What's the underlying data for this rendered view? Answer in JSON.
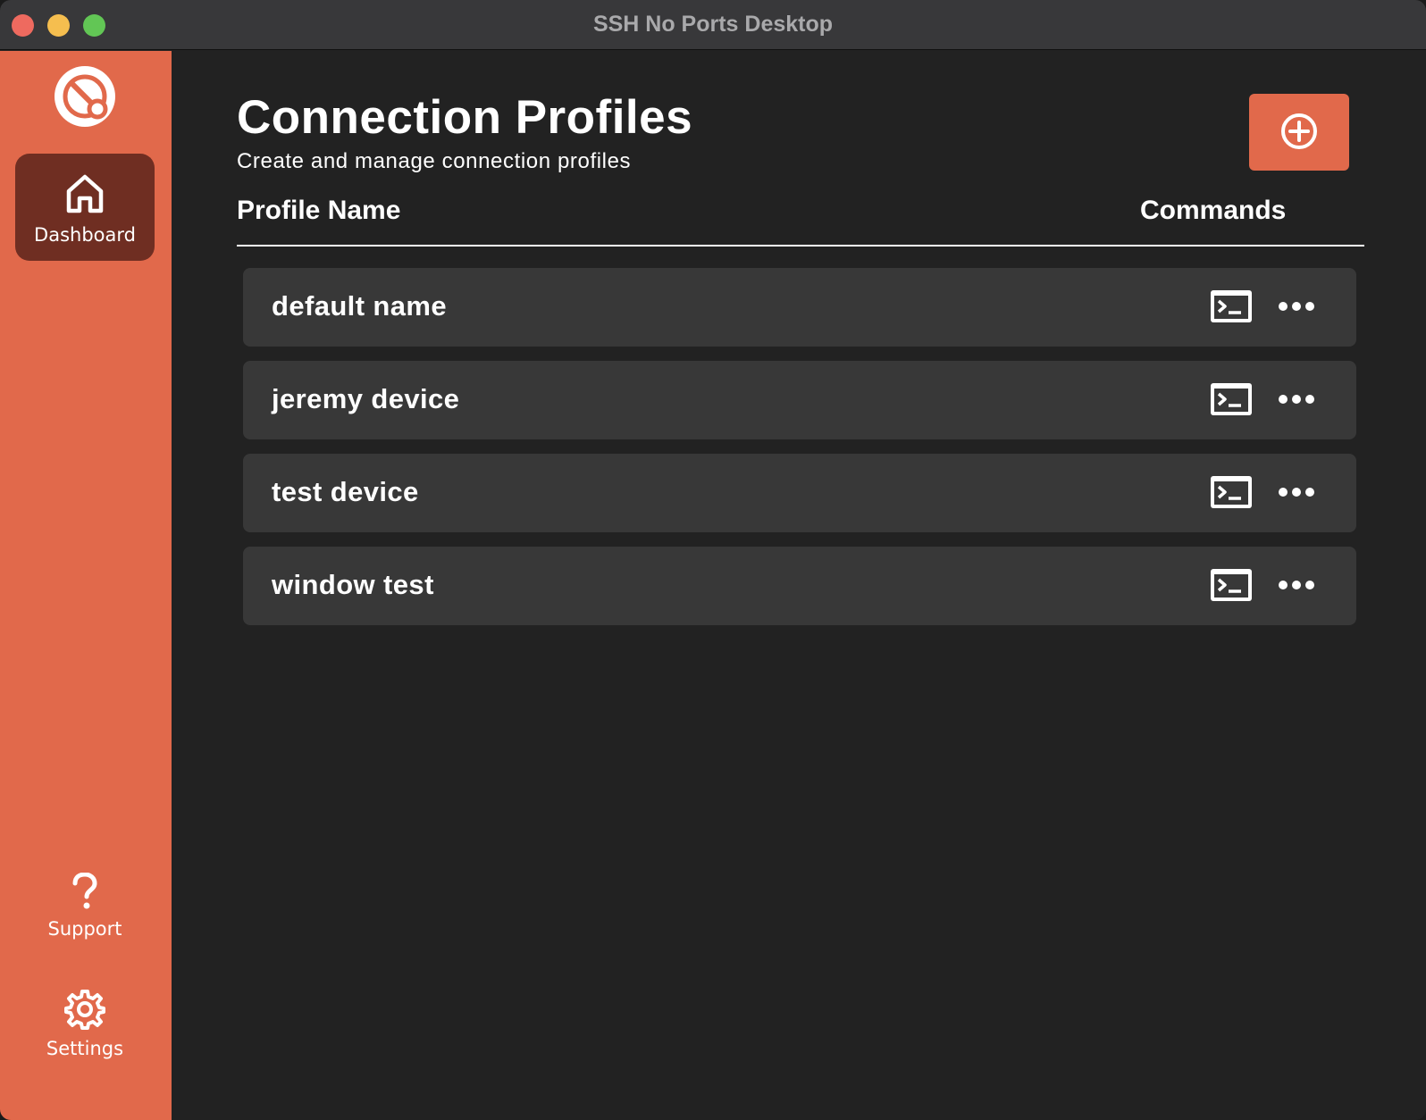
{
  "window": {
    "title": "SSH No Ports Desktop"
  },
  "sidebar": {
    "logo_icon": "sshnp-logo-icon",
    "items": [
      {
        "label": "Dashboard",
        "icon": "home-icon",
        "active": true
      },
      {
        "label": "Support",
        "icon": "question-mark-icon",
        "active": false
      },
      {
        "label": "Settings",
        "icon": "gear-icon",
        "active": false
      }
    ]
  },
  "main": {
    "title": "Connection Profiles",
    "subtitle": "Create and manage connection profiles",
    "add_button_icon": "plus-circle-icon",
    "columns": {
      "name": "Profile Name",
      "commands": "Commands"
    },
    "profiles": [
      {
        "name": "default name",
        "terminal_icon": "terminal-icon",
        "more_icon": "more-horizontal-icon"
      },
      {
        "name": "jeremy device",
        "terminal_icon": "terminal-icon",
        "more_icon": "more-horizontal-icon"
      },
      {
        "name": "test device",
        "terminal_icon": "terminal-icon",
        "more_icon": "more-horizontal-icon"
      },
      {
        "name": "window test",
        "terminal_icon": "terminal-icon",
        "more_icon": "more-horizontal-icon"
      }
    ]
  },
  "colors": {
    "accent": "#e1694b",
    "active_nav": "#6f2e22",
    "background": "#222222",
    "row": "#383838",
    "titlebar": "#38383a"
  }
}
